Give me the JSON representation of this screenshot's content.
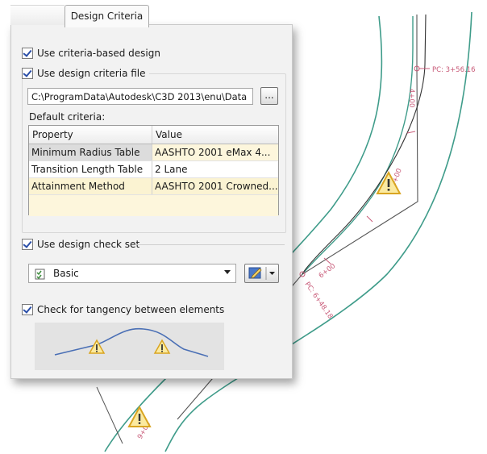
{
  "tab": {
    "label": "Design Criteria"
  },
  "options": {
    "use_criteria_based_design": "Use criteria-based design",
    "use_design_criteria_file": "Use design criteria file",
    "use_design_check_set": "Use design check set",
    "check_tangency": "Check for tangency between elements"
  },
  "criteria_file": {
    "path": "C:\\ProgramData\\Autodesk\\C3D 2013\\enu\\Data",
    "browse_label": "..."
  },
  "default_criteria": {
    "label": "Default criteria:",
    "columns": [
      "Property",
      "Value"
    ],
    "rows": [
      {
        "property": "Minimum Radius Table",
        "value": "AASHTO 2001 eMax 4..."
      },
      {
        "property": "Transition Length Table",
        "value": "2 Lane"
      },
      {
        "property": "Attainment Method",
        "value": "AASHTO 2001 Crowned..."
      }
    ]
  },
  "check_set": {
    "selected": "Basic"
  },
  "drawing": {
    "station_pc_top": "PC: 3+56.16",
    "station_4": "4+00",
    "station_6": "6+00",
    "station_pc_mid": "PC: 6+48.18",
    "station_9": "9+00",
    "station_5": "5+00"
  },
  "colors": {
    "alignment_green": "#3f9c8a",
    "label_pink": "#c85a78",
    "warning_yellow": "#e8c43a"
  }
}
